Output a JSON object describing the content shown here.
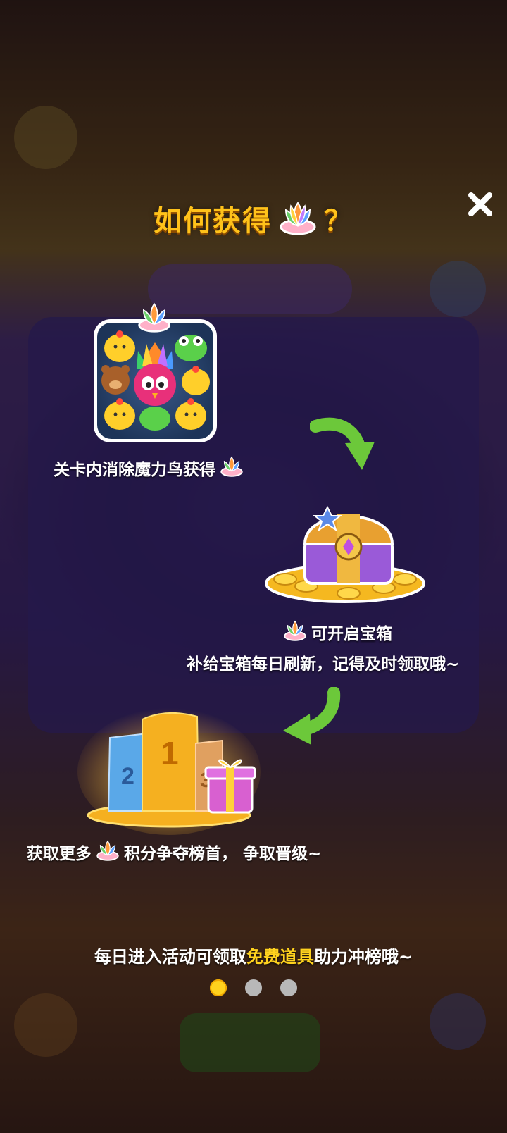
{
  "dialog": {
    "title": "如何获得",
    "title_suffix": "？",
    "lotus_icon": "rainbow-lotus-icon",
    "close_icon": "close-icon"
  },
  "steps": [
    {
      "text": "关卡内消除魔力鸟获得",
      "image": "match3-board-magic-bird"
    },
    {
      "line1": "可开启宝箱",
      "line2": "补给宝箱每日刷新，记得及时领取哦~",
      "image": "treasure-chest-with-coins"
    },
    {
      "text_before": "获取更多",
      "text_after": "积分争夺榜首， 争取晋级~",
      "image": "ranking-podium-with-gift"
    }
  ],
  "footer": {
    "prefix": "每日进入活动可领取",
    "highlight": "免费道具",
    "suffix": "助力冲榜哦~"
  },
  "pagination": {
    "total": 3,
    "current": 1
  },
  "colors": {
    "accent": "#ffc21a",
    "highlight": "#ffd21e",
    "arrow": "#6cc83a"
  }
}
